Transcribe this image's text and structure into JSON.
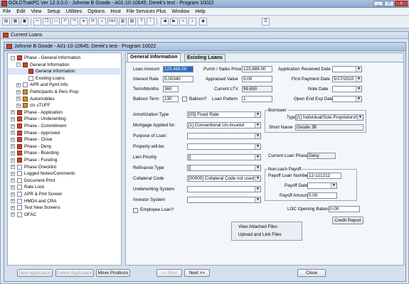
{
  "app": {
    "title": "GOLDTrakPC Ver 12.3.0.0 - Johnnie B Goode - A01-10-10645; Derek's test - Program 10022"
  },
  "window_controls": {
    "minimize": "_",
    "maximize": "□",
    "close": "x"
  },
  "menu": [
    "File",
    "Edit",
    "View",
    "Setup",
    "Utilities",
    "Options",
    "Host",
    "File Services Plus",
    "Window",
    "Help"
  ],
  "toolbar": {
    "icons": [
      "print-icon",
      "preview-icon",
      "save-icon",
      "cut-icon",
      "copy-icon",
      "paste-icon",
      "undo-icon",
      "redo-icon",
      "stop-icon",
      "refresh-icon",
      "search-icon",
      "fax-icon",
      "calendar-icon",
      "chart-icon",
      "help-icon",
      "info-icon",
      "back-arrow-icon",
      "forward-arrow-icon",
      "double-back-icon",
      "double-forward-icon",
      "tag-icon",
      "key-icon"
    ],
    "fax_label": "FAX"
  },
  "outer_window": {
    "title": "Current Loans"
  },
  "inner_window": {
    "title": "Johnnie B Goode - A01-10-10645; Derek's test - Program 10022"
  },
  "tree": [
    {
      "label": "Phase - General Information",
      "level": 0,
      "expanded": true,
      "icon": "red"
    },
    {
      "label": "General Information",
      "level": 1,
      "expanded": true,
      "icon": "red"
    },
    {
      "label": "General Information",
      "level": 2,
      "expanded": null,
      "icon": "red"
    },
    {
      "label": "Existing Loans",
      "level": 2,
      "expanded": null,
      "icon": "doc"
    },
    {
      "label": "APR and Pymt Info",
      "level": 1,
      "expanded": false,
      "icon": "doc"
    },
    {
      "label": "Participants & Pers Prop",
      "level": 1,
      "expanded": false,
      "icon": "book"
    },
    {
      "label": "Automobiles",
      "level": 1,
      "expanded": false,
      "icon": "book"
    },
    {
      "label": "cis sTUFF",
      "level": 1,
      "expanded": false,
      "icon": "book"
    },
    {
      "label": "Phase - Application",
      "level": 0,
      "expanded": false,
      "icon": "red"
    },
    {
      "label": "Phase - Underwriting",
      "level": 0,
      "expanded": false,
      "icon": "red"
    },
    {
      "label": "Phase - Commitment",
      "level": 0,
      "expanded": false,
      "icon": "red"
    },
    {
      "label": "Phase - Approved",
      "level": 0,
      "expanded": false,
      "icon": "red"
    },
    {
      "label": "Phase - Close",
      "level": 0,
      "expanded": false,
      "icon": "red"
    },
    {
      "label": "Phase - Deny",
      "level": 0,
      "expanded": false,
      "icon": "red"
    },
    {
      "label": "Phase - Boarding",
      "level": 0,
      "expanded": false,
      "icon": "red"
    },
    {
      "label": "Phase - Funding",
      "level": 0,
      "expanded": false,
      "icon": "red"
    },
    {
      "label": "Phase Checklist",
      "level": 0,
      "expanded": false,
      "icon": "doc"
    },
    {
      "label": "Logged Notes/Comments",
      "level": 0,
      "expanded": false,
      "icon": "doc"
    },
    {
      "label": "Document Print",
      "level": 0,
      "expanded": false,
      "icon": "doc"
    },
    {
      "label": "Rate Lock",
      "level": 0,
      "expanded": false,
      "icon": "doc"
    },
    {
      "label": "APR & Pmt Screen",
      "level": 0,
      "expanded": false,
      "icon": "doc"
    },
    {
      "label": "HMDA and CRA",
      "level": 0,
      "expanded": false,
      "icon": "doc"
    },
    {
      "label": "Test New Screens",
      "level": 0,
      "expanded": false,
      "icon": "doc"
    },
    {
      "label": "OFAC",
      "level": 0,
      "expanded": false,
      "icon": "doc"
    }
  ],
  "tabs": [
    "General Information",
    "Existing Loans"
  ],
  "form": {
    "loan_amount": {
      "label": "Loan Amount",
      "value": "123,456.00"
    },
    "purch_sales_price": {
      "label": "Purch / Sales Price",
      "value": "123,888.00"
    },
    "app_received_date": {
      "label": "Application Received Date",
      "value": ""
    },
    "interest_rate": {
      "label": "Interest Rate",
      "value": "5.00340"
    },
    "appraised_value": {
      "label": "Appraised Value",
      "value": "0.00"
    },
    "first_payment_date": {
      "label": "First Payment Date",
      "value": "5/17/2010"
    },
    "term_months": {
      "label": "Term/Months",
      "value": "360"
    },
    "current_ltv": {
      "label": "Current LTV",
      "value": "99.650"
    },
    "note_date": {
      "label": "Note Date",
      "value": ""
    },
    "balloon_term": {
      "label": "Balloon Term",
      "value": "130"
    },
    "balloon_q": {
      "label": "Balloon?"
    },
    "loan_pattern": {
      "label": "Loan Pattern",
      "value": "1"
    },
    "open_end_exp_date": {
      "label": "Open End Exp Date",
      "value": ""
    },
    "amortization_type": {
      "label": "Amortization Type",
      "value": "[05] Fixed Rate"
    },
    "mortgage_applied_for": {
      "label": "Mortgage Applied for:",
      "value": "[1] Conventional Un-insured"
    },
    "purpose_of_loan": {
      "label": "Purpose of Loan:",
      "value": ""
    },
    "property_will_be": {
      "label": "Property will be:",
      "value": ""
    },
    "lien_priority": {
      "label": "Lien Priority",
      "value": "[]"
    },
    "refinance_type": {
      "label": "Refinance Type",
      "value": "[]"
    },
    "collateral_code": {
      "label": "Collateral Code",
      "value": "[00000] Collateral Code not used"
    },
    "underwriting_system": {
      "label": "Underwriting System",
      "value": ""
    },
    "investor_system": {
      "label": "Investor System",
      "value": ""
    },
    "employee_loan": {
      "label": "Employee Loan?"
    },
    "borrower": {
      "title": "Borrower",
      "type_label": "Type",
      "type_value": "[1] Individual/Sole Proprietorship",
      "short_name_label": "Short Name",
      "short_name_value": "Goode JB"
    },
    "current_loan_phase": {
      "label": "Current Loan Phase",
      "value": "Deny"
    },
    "noncash_payoff": {
      "title": "Non-cash Payoff",
      "loan_number_label": "Payoff Loan Number",
      "loan_number_value": "12-121212",
      "date_label": "Payoff Date",
      "date_value": "",
      "amount_label": "Payoff Amount",
      "amount_value": "0.00"
    },
    "loc_opening_balance": {
      "label": "LOC Opening Balance",
      "value": "0.00"
    },
    "credit_report": "Credit Report"
  },
  "context_menu": [
    "View Attached Files",
    "Upload and Link Files"
  ],
  "footer": {
    "new_application": "New Application",
    "delete_application": "Delete Application",
    "move_positions": "Move Positions",
    "prev": "<< Prev",
    "next": "Next >>",
    "close": "Close"
  },
  "arrow_glyph": "▼"
}
